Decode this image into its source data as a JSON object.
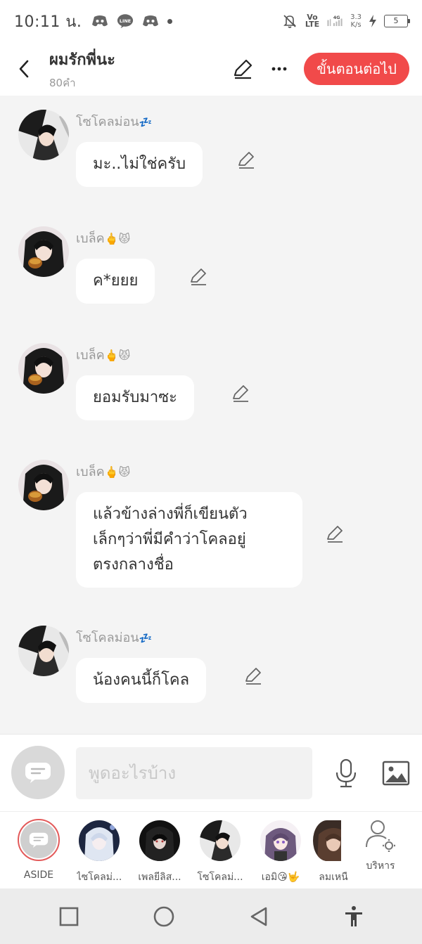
{
  "status_bar": {
    "time": "10:11 น.",
    "network_label": "4G",
    "volte_label": "Vo\nLTE",
    "speed_value": "3.3",
    "speed_unit": "K/s",
    "battery_level": "5"
  },
  "header": {
    "title": "ผมรักพี่นะ",
    "word_count": "80คำ",
    "next_button": "ขั้นตอนต่อไป",
    "accent_color": "#f14a4a"
  },
  "messages": [
    {
      "sender": "โซโคลม่อน",
      "sender_emoji": "💤",
      "text": "มะ..ไม่ใช่ครับ",
      "avatar": "solomon"
    },
    {
      "sender": "เบล็ค",
      "sender_emoji": "🖕😾",
      "text": "ค*ยยย",
      "avatar": "black"
    },
    {
      "sender": "เบล็ค",
      "sender_emoji": "🖕😾",
      "text": "ยอมรับมาซะ",
      "avatar": "black"
    },
    {
      "sender": "เบล็ค",
      "sender_emoji": "🖕😾",
      "text": "แล้วข้างล่างพี่ก็เขียนตัวเล็กๆว่าพี่มีคำว่าโคลอยู่ตรงกลางชื่อ",
      "text_lines": [
        "แล้วข้างล่างพี่ก็เขียนตัว",
        "เล็กๆว่าพี่มีคำว่าโคลอยู่",
        "ตรงกลางชื่อ"
      ],
      "avatar": "black"
    },
    {
      "sender": "โซโคลม่อน",
      "sender_emoji": "💤",
      "text": "น้องคนนี้ก็โคล",
      "avatar": "solomon"
    }
  ],
  "composer": {
    "placeholder": "พูดอะไรบ้าง"
  },
  "characters": [
    {
      "label": "ASIDE"
    },
    {
      "label": "ไซโคลม่..."
    },
    {
      "label": "เพลยีลิส..."
    },
    {
      "label": "โซโคลม่..."
    },
    {
      "label": "เอมิ😘🤟"
    },
    {
      "label": "ลมเหนื"
    },
    {
      "label": "บริหาร"
    }
  ],
  "icons": {
    "status": [
      "discord-icon",
      "line-icon",
      "discord-icon",
      "dot-icon",
      "mute-icon",
      "signal-icon",
      "charging-icon",
      "battery-icon"
    ],
    "header": [
      "back-arrow-icon",
      "pencil-icon",
      "more-icon"
    ],
    "composer": [
      "chat-bubble-icon",
      "microphone-icon",
      "image-icon"
    ],
    "nav": [
      "square-icon",
      "circle-icon",
      "triangle-back-icon",
      "accessibility-icon"
    ]
  }
}
